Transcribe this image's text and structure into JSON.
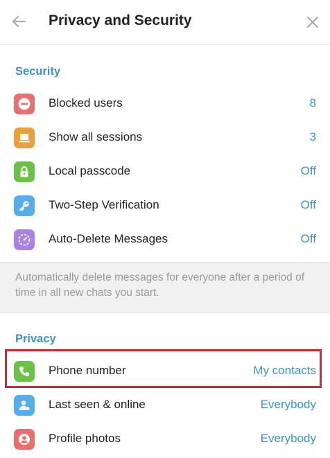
{
  "header": {
    "title": "Privacy and Security"
  },
  "security": {
    "section_title": "Security",
    "items": [
      {
        "label": "Blocked users",
        "value": "8",
        "icon": "blocked-icon",
        "color": "#e96e6e"
      },
      {
        "label": "Show all sessions",
        "value": "3",
        "icon": "laptop-icon",
        "color": "#eba03a"
      },
      {
        "label": "Local passcode",
        "value": "Off",
        "icon": "lock-icon",
        "color": "#6ac247"
      },
      {
        "label": "Two-Step Verification",
        "value": "Off",
        "icon": "key-icon",
        "color": "#55aeec"
      },
      {
        "label": "Auto-Delete Messages",
        "value": "Off",
        "icon": "timer-icon",
        "color": "#a982e4"
      }
    ]
  },
  "info": {
    "text": "Automatically delete messages for everyone after a period of time in all new chats you start."
  },
  "privacy": {
    "section_title": "Privacy",
    "items": [
      {
        "label": "Phone number",
        "value": "My contacts",
        "icon": "phone-icon",
        "color": "#6ac247"
      },
      {
        "label": "Last seen & online",
        "value": "Everybody",
        "icon": "person-online-icon",
        "color": "#55aeec"
      },
      {
        "label": "Profile photos",
        "value": "Everybody",
        "icon": "profile-photo-icon",
        "color": "#e96e6e"
      }
    ]
  },
  "colors": {
    "accent": "#3a95c9",
    "highlight_border": "#e0202a"
  }
}
